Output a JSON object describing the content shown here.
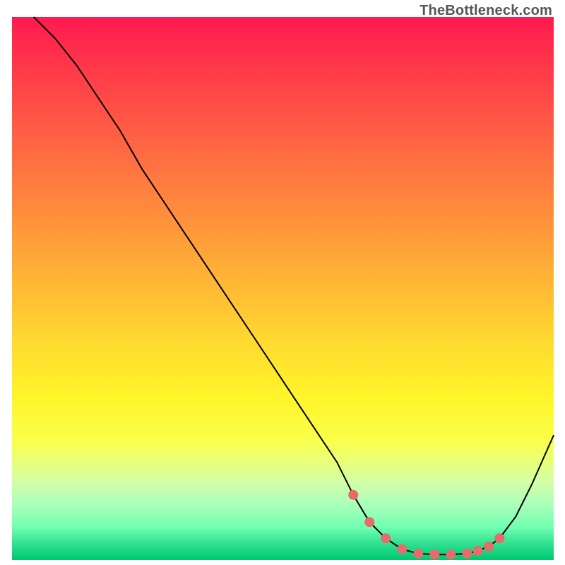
{
  "watermark": "TheBottleneck.com",
  "chart_data": {
    "type": "line",
    "title": "",
    "xlabel": "",
    "ylabel": "",
    "xlim": [
      0,
      100
    ],
    "ylim": [
      0,
      100
    ],
    "x": [
      0,
      4,
      8,
      12,
      16,
      20,
      24,
      28,
      32,
      36,
      40,
      44,
      48,
      52,
      56,
      60,
      63,
      66,
      69,
      72,
      75,
      78,
      81,
      84,
      86,
      88,
      90,
      93,
      96,
      100
    ],
    "values": [
      null,
      100,
      96,
      91,
      85,
      79,
      72,
      66,
      60,
      54,
      48,
      42,
      36,
      30,
      24,
      18,
      12,
      7,
      4,
      2,
      1.2,
      1,
      1,
      1.2,
      1.7,
      2.5,
      4,
      8,
      14,
      23
    ],
    "markers": {
      "x": [
        63,
        66,
        69,
        72,
        75,
        78,
        81,
        84,
        86,
        88,
        90
      ],
      "y": [
        12,
        7,
        4,
        2,
        1.2,
        1,
        1,
        1.2,
        1.7,
        2.5,
        4
      ]
    },
    "colors": {
      "line": "#000000",
      "marker": "#e86a6a",
      "gradient_top": "#ff1a4f",
      "gradient_bottom": "#00c870"
    }
  }
}
